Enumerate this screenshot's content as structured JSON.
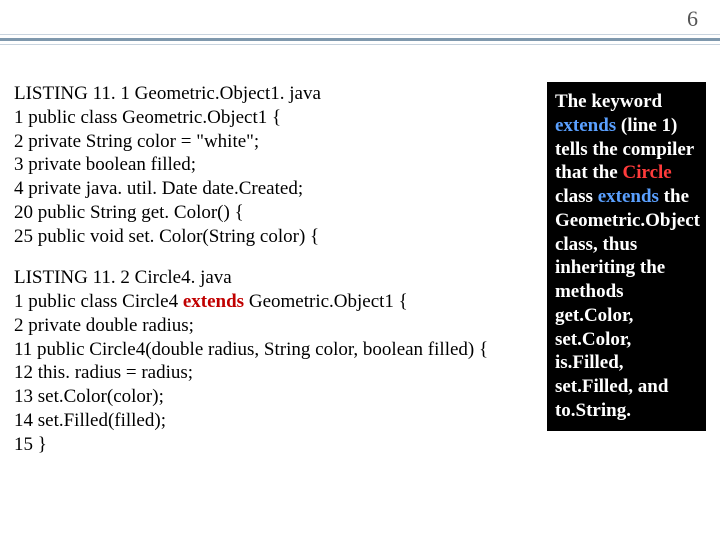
{
  "page_number": "6",
  "listing1": {
    "title": "LISTING 11. 1 Geometric.Object1. java",
    "lines": [
      "1 public class Geometric.Object1 {",
      "2 private String color = \"white\";",
      "3 private boolean filled;",
      "4 private java. util. Date date.Created;",
      "20 public String get. Color() {",
      "25 public void set. Color(String color) {"
    ]
  },
  "listing2": {
    "title": "LISTING 11. 2 Circle4. java",
    "line1_pre": "1 public class Circle4 ",
    "line1_kw": "extends",
    "line1_post": " Geometric.Object1 {",
    "lines_rest": [
      "2 private double radius;",
      "11 public Circle4(double radius, String color, boolean filled) {",
      "12 this. radius = radius;",
      "13 set.Color(color);",
      "14 set.Filled(filled);",
      "15 }"
    ]
  },
  "callout": {
    "t1": "The keyword ",
    "t2": "extends",
    "t3": " (line 1) tells the compiler that the ",
    "t4": "Circle",
    "t5": " class ",
    "t6": "extends",
    "t7": " the ",
    "t8": "Geometric.Object class",
    "t9": ", thus inheriting the methods get.Color, set.Color, is.Filled, set.Filled, and to.String."
  }
}
